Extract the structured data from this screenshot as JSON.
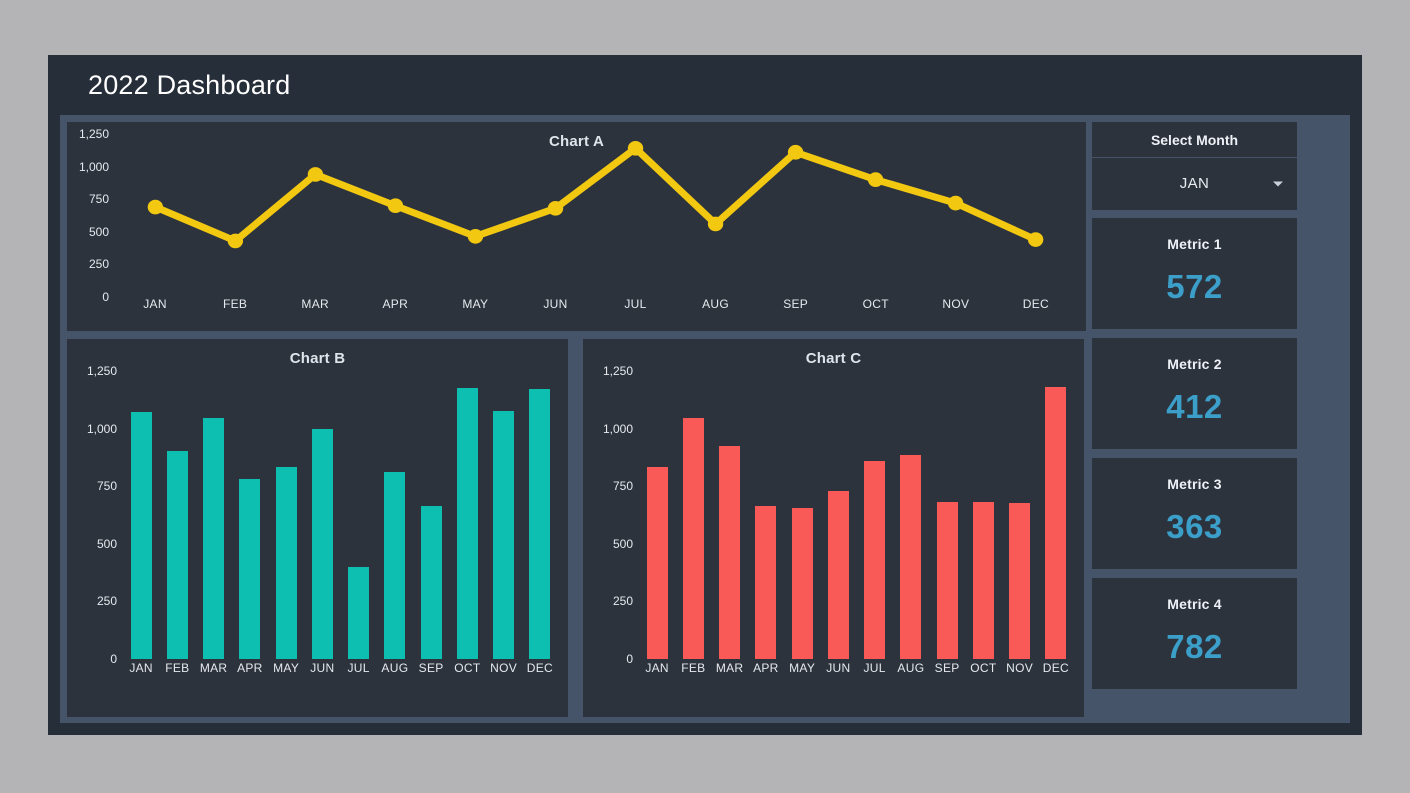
{
  "header": {
    "title": "2022 Dashboard"
  },
  "colors": {
    "page_background": "#b4b4b6",
    "frame_background": "#262e3a",
    "panel_background": "#46546a",
    "card_background": "#2c333d",
    "chart_a_line": "#f2c811",
    "chart_b_bar": "#0cbfb0",
    "chart_c_bar": "#fa5a57",
    "metric_value": "#3b9fc9",
    "axis_text": "#e6e9ee"
  },
  "sidebar": {
    "select_month_label": "Select Month",
    "month_selected": "JAN",
    "chevron_icon": "chevron-down-icon",
    "metrics": [
      {
        "title": "Metric 1",
        "value": "572"
      },
      {
        "title": "Metric 2",
        "value": "412"
      },
      {
        "title": "Metric 3",
        "value": "363"
      },
      {
        "title": "Metric 4",
        "value": "782"
      }
    ]
  },
  "chart_data": [
    {
      "type": "line",
      "title": "Chart A",
      "xlabel": "",
      "ylabel": "",
      "categories": [
        "JAN",
        "FEB",
        "MAR",
        "APR",
        "MAY",
        "JUN",
        "JUL",
        "AUG",
        "SEP",
        "OCT",
        "NOV",
        "DEC"
      ],
      "values": [
        690,
        430,
        940,
        700,
        465,
        680,
        1140,
        560,
        1110,
        900,
        720,
        440
      ],
      "ylim": [
        0,
        1250
      ],
      "yticks": [
        1250,
        1000,
        750,
        500,
        250,
        0
      ],
      "ytick_labels": [
        "1,250",
        "1,000",
        "750",
        "500",
        "250",
        "0"
      ],
      "grid": false,
      "legend": "none",
      "marker": "circle",
      "color": "#f2c811"
    },
    {
      "type": "bar",
      "title": "Chart B",
      "xlabel": "",
      "ylabel": "",
      "categories": [
        "JAN",
        "FEB",
        "MAR",
        "APR",
        "MAY",
        "JUN",
        "JUL",
        "AUG",
        "SEP",
        "OCT",
        "NOV",
        "DEC"
      ],
      "values": [
        1070,
        905,
        1045,
        780,
        835,
        1000,
        400,
        810,
        665,
        1175,
        1075,
        1170
      ],
      "ylim": [
        0,
        1250
      ],
      "yticks": [
        1250,
        1000,
        750,
        500,
        250,
        0
      ],
      "ytick_labels": [
        "1,250",
        "1,000",
        "750",
        "500",
        "250",
        "0"
      ],
      "grid": false,
      "legend": "none",
      "color": "#0cbfb0"
    },
    {
      "type": "bar",
      "title": "Chart C",
      "xlabel": "",
      "ylabel": "",
      "categories": [
        "JAN",
        "FEB",
        "MAR",
        "APR",
        "MAY",
        "JUN",
        "JUL",
        "AUG",
        "SEP",
        "OCT",
        "NOV",
        "DEC"
      ],
      "values": [
        835,
        1045,
        925,
        665,
        655,
        730,
        860,
        885,
        680,
        680,
        675,
        1180
      ],
      "ylim": [
        0,
        1250
      ],
      "yticks": [
        1250,
        1000,
        750,
        500,
        250,
        0
      ],
      "ytick_labels": [
        "1,250",
        "1,000",
        "750",
        "500",
        "250",
        "0"
      ],
      "grid": false,
      "legend": "none",
      "color": "#fa5a57"
    }
  ]
}
